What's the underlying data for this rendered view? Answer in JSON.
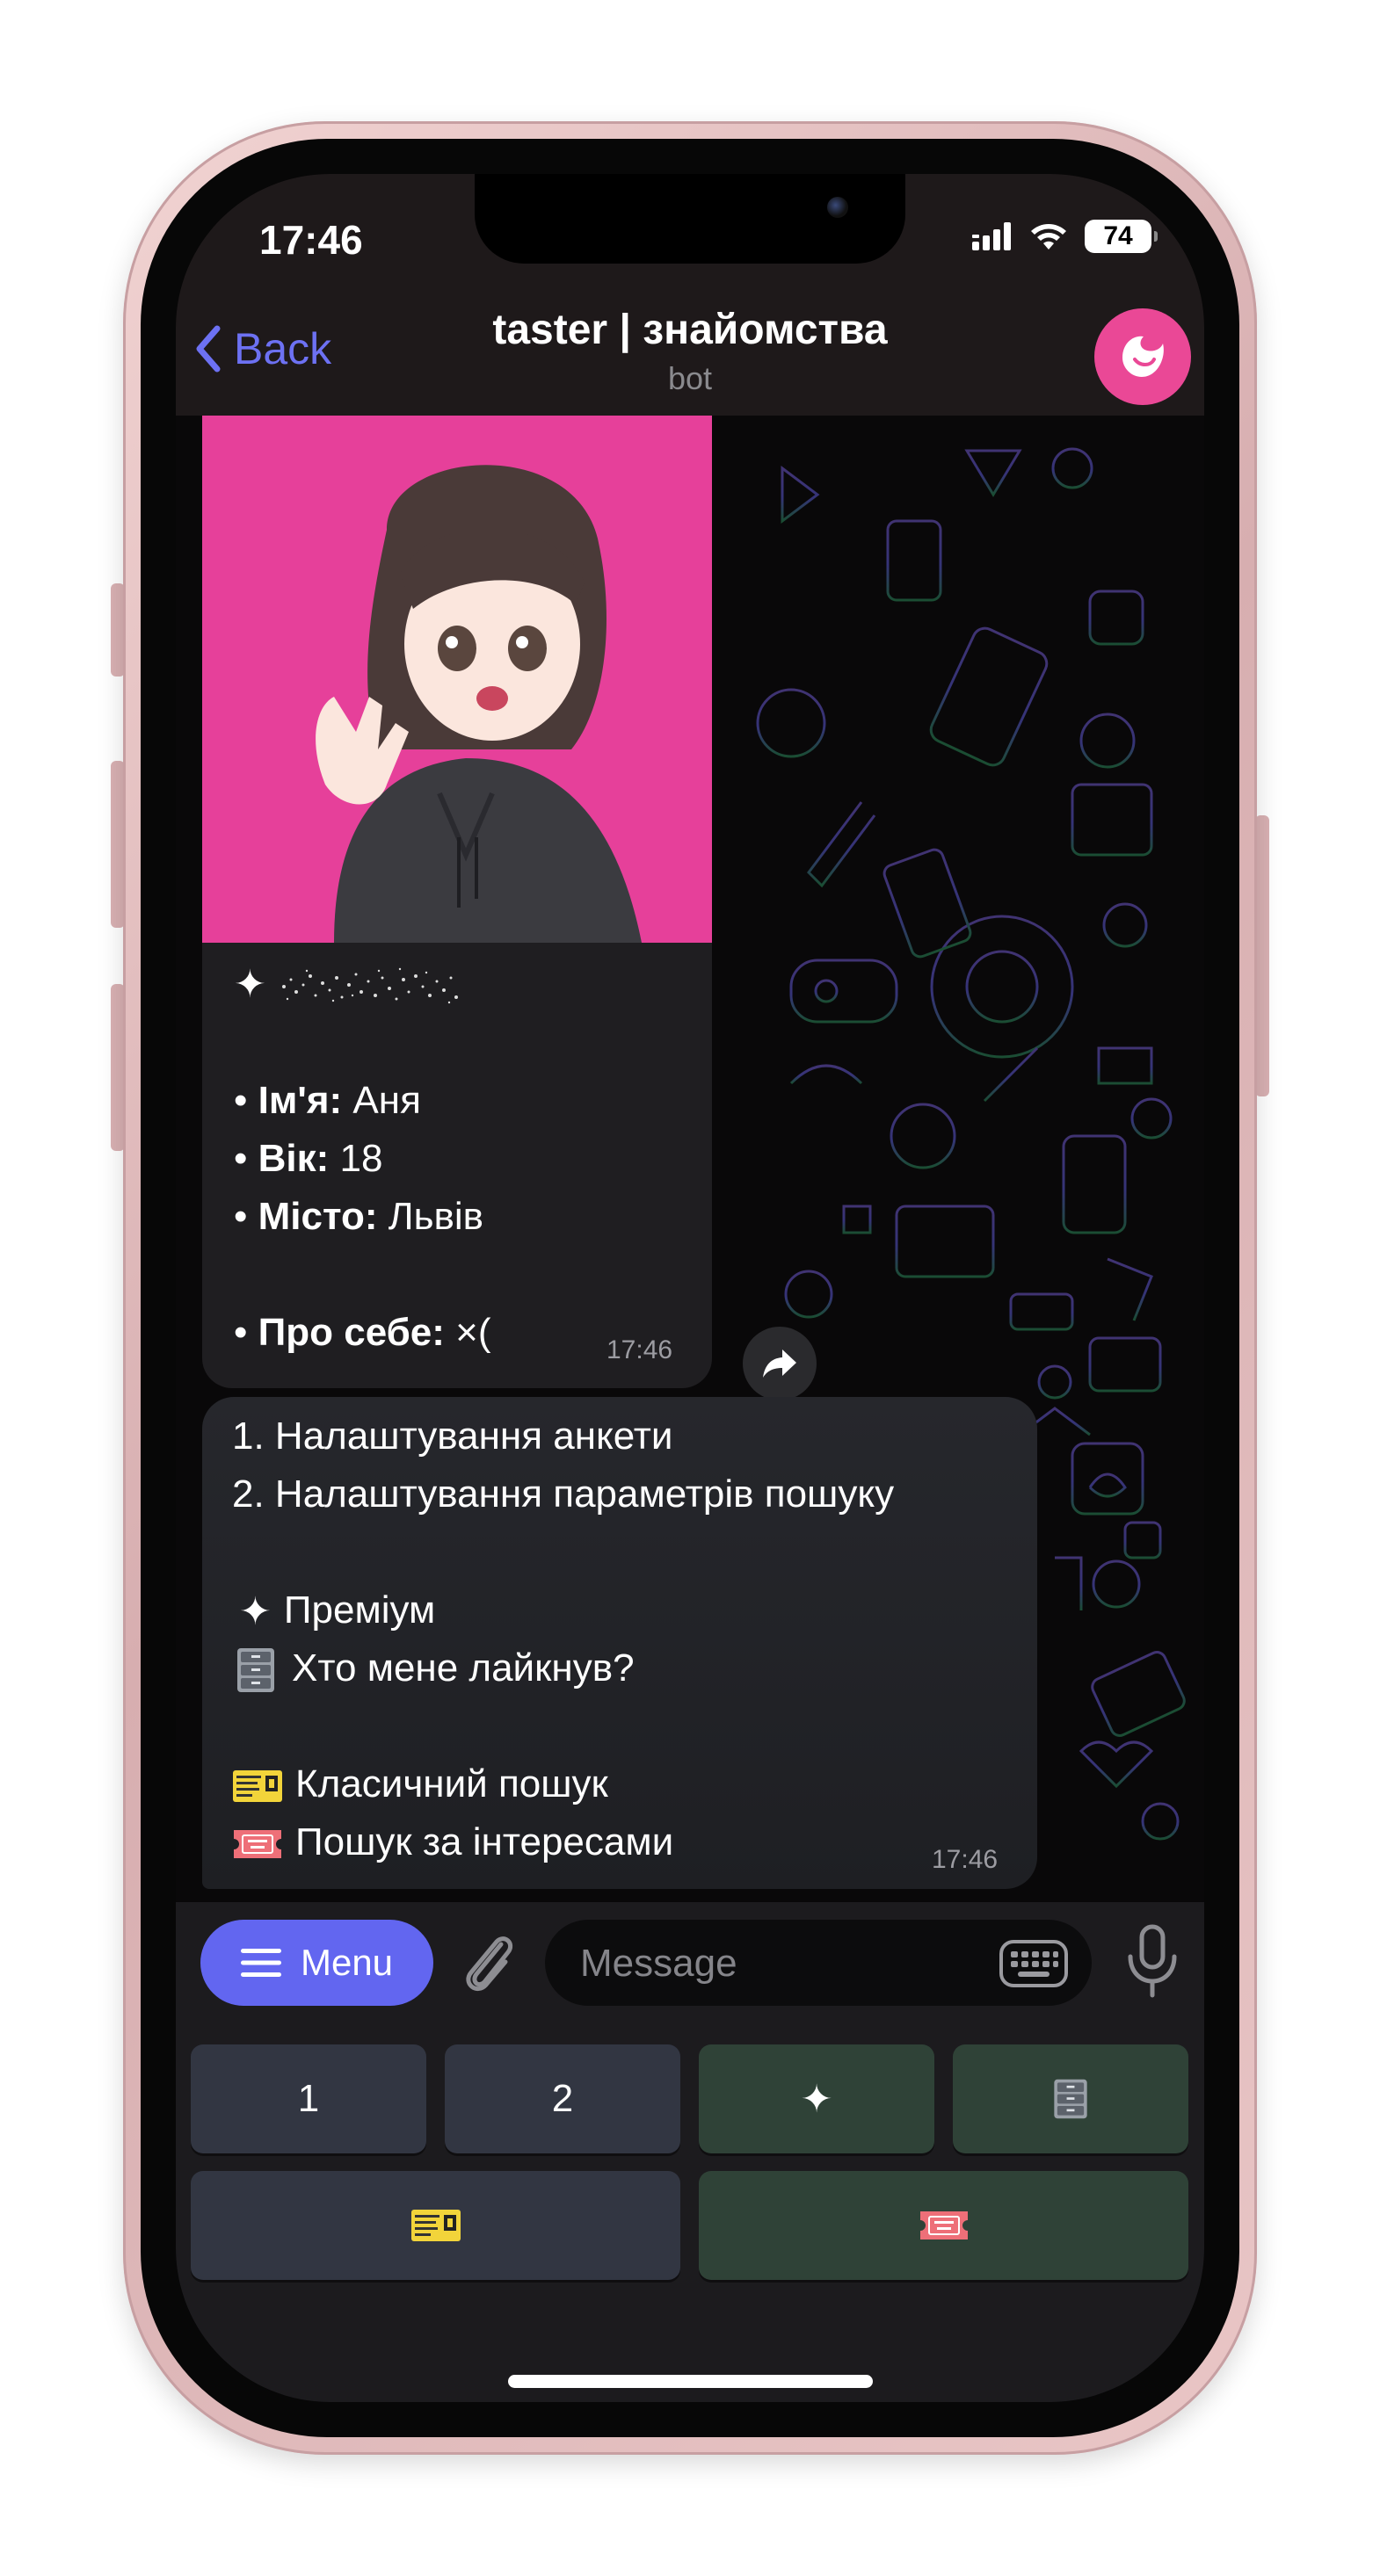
{
  "status_bar": {
    "time": "17:46",
    "battery": "74"
  },
  "header": {
    "back_label": "Back",
    "title": "taster | знайомства",
    "subtitle": "bot"
  },
  "profile_message": {
    "lines": [
      {
        "label": "Ім'я:",
        "value": " Аня"
      },
      {
        "label": "Вік:",
        "value": " 18"
      },
      {
        "label": "Місто:",
        "value": " Львів"
      },
      {
        "label": "Про себе:",
        "value": " ×("
      }
    ],
    "time": "17:46"
  },
  "menu_message": {
    "lines": [
      "1. Налаштування анкети",
      "2. Налаштування параметрів пошуку",
      "Преміум",
      "Хто мене лайкнув?",
      "Класичний пошук",
      "Пошук за інтересами"
    ],
    "time": "17:46"
  },
  "input_bar": {
    "menu_label": "Menu",
    "message_placeholder": "Message"
  },
  "keyboard": {
    "row1": [
      "1",
      "2"
    ]
  },
  "colors": {
    "accent": "#6266f0",
    "bot_avatar": "#ea4896",
    "photo_background": "#e6409a"
  }
}
